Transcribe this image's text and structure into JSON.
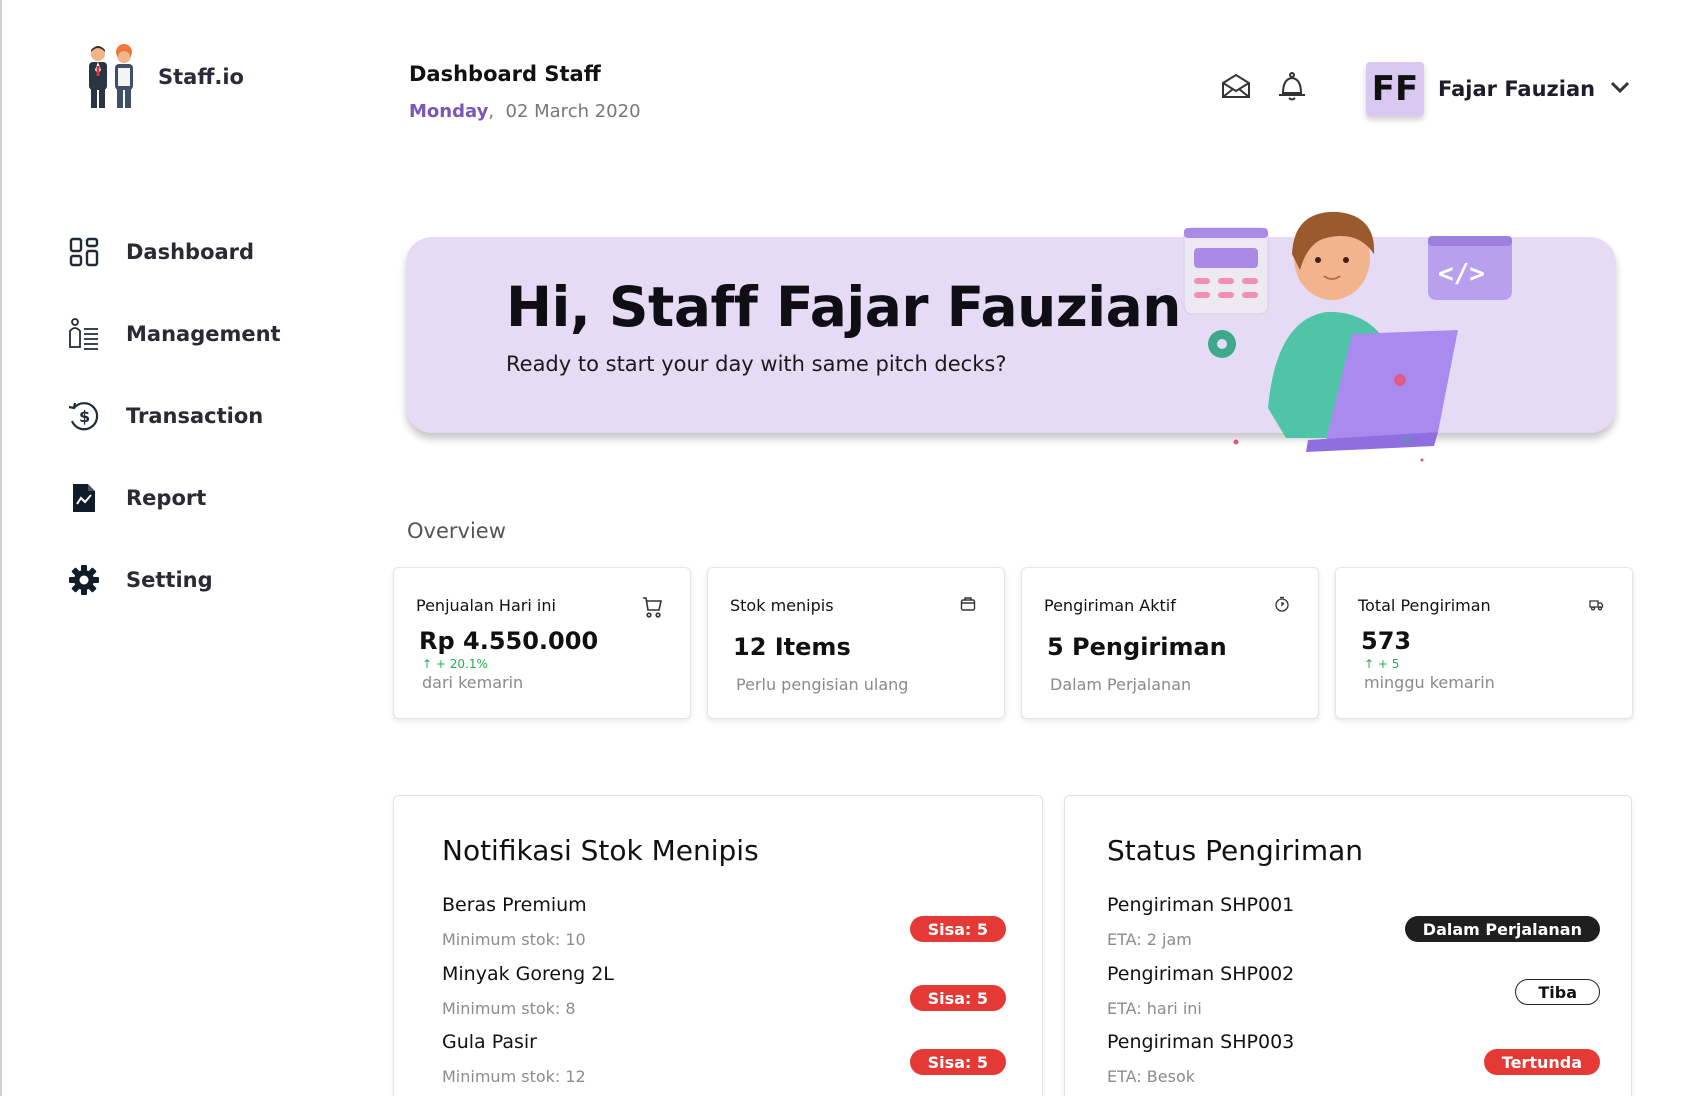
{
  "app": {
    "name": "Staff.io"
  },
  "header": {
    "title": "Dashboard Staff",
    "day": "Monday",
    "separator": ",",
    "date": "02 March 2020",
    "user_initials": "FF",
    "user_name": "Fajar Fauzian"
  },
  "sidebar": {
    "items": [
      {
        "label": "Dashboard",
        "icon": "grid-icon"
      },
      {
        "label": "Management",
        "icon": "management-icon"
      },
      {
        "label": "Transaction",
        "icon": "transaction-icon"
      },
      {
        "label": "Report",
        "icon": "report-icon"
      },
      {
        "label": "Setting",
        "icon": "gear-icon"
      }
    ]
  },
  "banner": {
    "title": "Hi, Staff Fajar Fauzian",
    "subtitle": "Ready to start your day with same pitch decks?"
  },
  "overview": {
    "label": "Overview",
    "cards": [
      {
        "title": "Penjualan Hari ini",
        "value": "Rp 4.550.000",
        "trend": "+ 20.1%",
        "note": "dari kemarin",
        "icon": "cart-icon"
      },
      {
        "title": "Stok menipis",
        "value": "12 Items",
        "note": "Perlu pengisian ulang",
        "icon": "box-icon"
      },
      {
        "title": "Pengiriman Aktif",
        "value": "5 Pengiriman",
        "note": "Dalam Perjalanan",
        "icon": "clock-icon"
      },
      {
        "title": "Total Pengiriman",
        "value": "573",
        "trend": "+ 5",
        "note": "minggu kemarin",
        "icon": "truck-icon"
      }
    ]
  },
  "stock_panel": {
    "title": "Notifikasi Stok Menipis",
    "items": [
      {
        "name": "Beras Premium",
        "min": "Minimum stok: 10",
        "badge": "Sisa: 5"
      },
      {
        "name": "Minyak Goreng 2L",
        "min": "Minimum stok: 8",
        "badge": "Sisa: 5"
      },
      {
        "name": "Gula Pasir",
        "min": "Minimum stok: 12",
        "badge": "Sisa: 5"
      }
    ]
  },
  "shipping_panel": {
    "title": "Status Pengiriman",
    "items": [
      {
        "name": "Pengiriman SHP001",
        "eta": "ETA: 2 jam",
        "status": "Dalam Perjalanan"
      },
      {
        "name": "Pengiriman SHP002",
        "eta": "ETA: hari ini",
        "status": "Tiba"
      },
      {
        "name": "Pengiriman SHP003",
        "eta": "ETA: Besok",
        "status": "Tertunda"
      }
    ]
  },
  "colors": {
    "accent": "#7c55b8",
    "banner_bg": "#e6dbf5",
    "avatar_bg": "#d8c8f2",
    "danger": "#e53935",
    "success": "#22b14c"
  }
}
